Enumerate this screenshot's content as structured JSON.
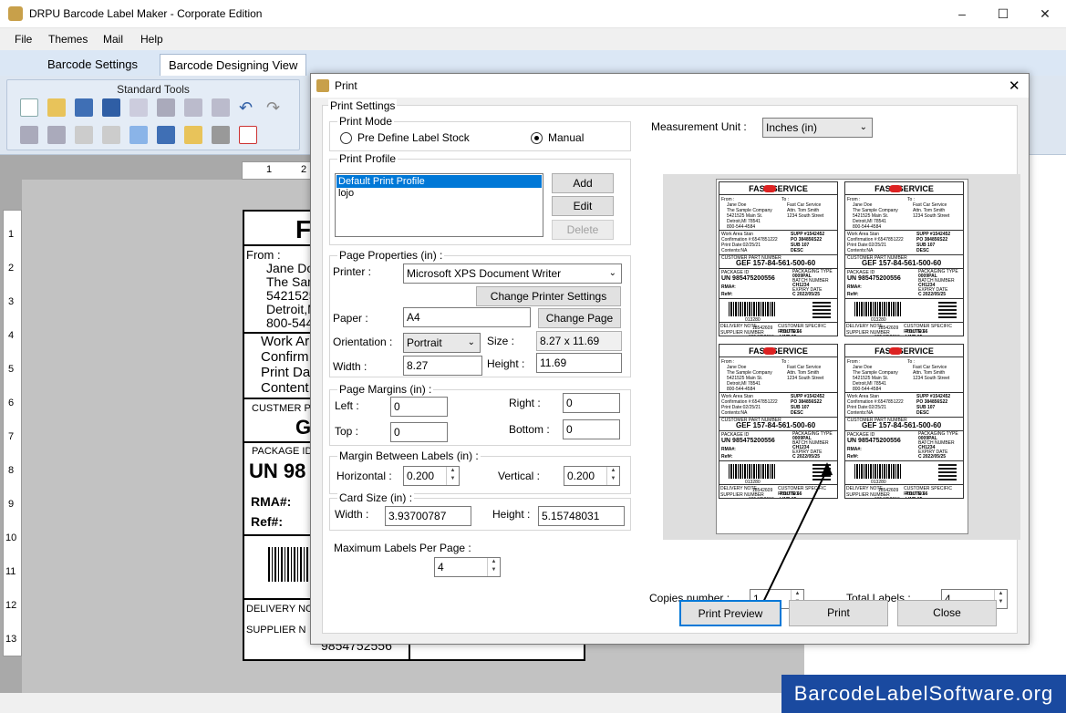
{
  "app": {
    "title": "DRPU Barcode Label Maker - Corporate Edition"
  },
  "menu": [
    "File",
    "Themes",
    "Mail",
    "Help"
  ],
  "tabs": [
    "Barcode Settings",
    "Barcode Designing View"
  ],
  "standard_tools": {
    "label": "Standard Tools"
  },
  "ruler": {
    "top": [
      "1",
      "2"
    ],
    "left": [
      "1",
      "2",
      "3",
      "4",
      "5",
      "6",
      "7",
      "8",
      "9",
      "10",
      "11",
      "12",
      "13"
    ]
  },
  "label_canvas": {
    "header": "F",
    "from": [
      "From :",
      "Jane Do",
      "The Sam",
      "5421525",
      "Detroit,M",
      "800-544"
    ],
    "work": [
      "Work Ar",
      "Confirm",
      "Print Da",
      "Content"
    ],
    "customer": "CUSTMER P",
    "customer_val": "G",
    "package": "PACKAGE ID",
    "un": "UN 98",
    "rma": "RMA#:",
    "ref": "Ref#:",
    "delivery": "DELIVERY NO",
    "supplier": "SUPPLIER  N",
    "supplier_num": "9854752556"
  },
  "dialog": {
    "title": "Print",
    "print_settings": "Print Settings",
    "print_mode": {
      "title": "Print Mode",
      "option1": "Pre Define Label Stock",
      "option2": "Manual"
    },
    "print_profile": {
      "title": "Print Profile",
      "items": [
        "Default Print Profile",
        "lojo"
      ],
      "add": "Add",
      "edit": "Edit",
      "delete": "Delete"
    },
    "page_properties": {
      "title": "Page Properties (in) :",
      "printer_label": "Printer :",
      "printer": "Microsoft XPS Document Writer",
      "change_printer": "Change Printer Settings",
      "paper_label": "Paper :",
      "paper": "A4",
      "change_page": "Change Page",
      "orientation_label": "Orientation :",
      "orientation": "Portrait",
      "size_label": "Size :",
      "size": "8.27 x 11.69",
      "width_label": "Width :",
      "width": "8.27",
      "height_label": "Height :",
      "height": "11.69"
    },
    "page_margins": {
      "title": "Page Margins (in) :",
      "left_label": "Left :",
      "left": "0",
      "right_label": "Right :",
      "right": "0",
      "top_label": "Top :",
      "top": "0",
      "bottom_label": "Bottom :",
      "bottom": "0"
    },
    "margin_between": {
      "title": "Margin Between Labels (in) :",
      "horizontal_label": "Horizontal :",
      "horizontal": "0.200",
      "vertical_label": "Vertical :",
      "vertical": "0.200"
    },
    "card_size": {
      "title": "Card Size (in) :",
      "width_label": "Width :",
      "width": "3.93700787",
      "height_label": "Height :",
      "height": "5.15748031"
    },
    "max_labels": {
      "title": "Maximum Labels Per Page :",
      "value": "4"
    },
    "measurement": {
      "label": "Measurement Unit :",
      "value": "Inches (in)"
    },
    "copies": {
      "label": "Copies number :",
      "value": "1"
    },
    "total": {
      "label": "Total Labels :",
      "value": "4"
    },
    "buttons": {
      "preview": "Print Preview",
      "print": "Print",
      "close": "Close"
    }
  },
  "preview_card": {
    "header": "FAST   SERVICE",
    "from_lines": [
      "From :",
      "Jane Doe",
      "The Sample Company",
      "5421525 Main St.",
      "Detroit,MI 78541",
      "800-544-4584"
    ],
    "to_lines": [
      "To :",
      "Fast Car Service",
      "Attn. Tom Smith",
      "1234 South Street"
    ],
    "work_lines": [
      "Work Area Stan",
      "Confirmation #:6547851222",
      "Print Date:02/25/21",
      "Contents:NA"
    ],
    "supp": [
      "SUPP #1542452",
      "PO  384856S22",
      "SUB  107",
      "DESC"
    ],
    "part_label": "CUSTOMER  PART NUMBER",
    "part": "GEF 157-84-561-500-60",
    "package_label": "PACKAGE ID",
    "un": "UN 985475200556",
    "type_label": "PACKAGING TYPE",
    "type": "0009PAL",
    "batch_label": "BATCH NUMBER",
    "batch": "CH1234",
    "expiry_label": "EXPIRY DATE",
    "expiry": "C 2022/05/25",
    "rma": "RMA#:",
    "ref": "Ref#:",
    "bc_num": "013280",
    "delivery_label": "DELIVERY NOTE",
    "delivery": "18542609",
    "supplier_label": "SUPPLIER  NUMBER",
    "supplier": "9854752556",
    "routing_label": "CUSTOMER  SPECIFIC  ROUTING",
    "route": "ROUTE 66",
    "line": "LINE 15"
  },
  "watermark": "BarcodeLabelSoftware.org",
  "colors": {
    "accent": "#0078d7",
    "watermark_bg": "#1a4aa0",
    "ribbon": "#dde6f1"
  }
}
